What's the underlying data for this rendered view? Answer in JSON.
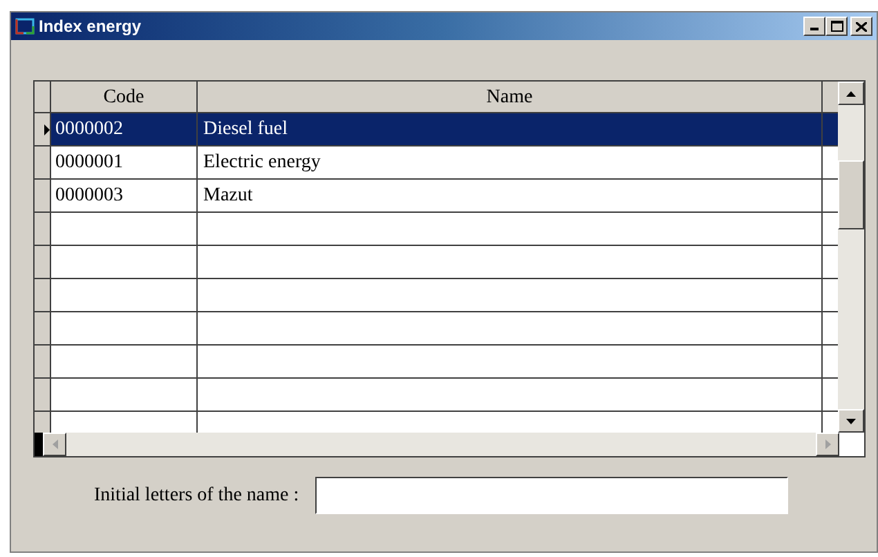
{
  "window": {
    "title": "Index energy"
  },
  "table": {
    "columns": [
      "Code",
      "Name"
    ],
    "rows": [
      {
        "code": "0000002",
        "name": "Diesel fuel",
        "selected": true
      },
      {
        "code": "0000001",
        "name": "Electric energy",
        "selected": false
      },
      {
        "code": "0000003",
        "name": "Mazut",
        "selected": false
      }
    ]
  },
  "filter": {
    "label": "Initial letters of the name :"
  }
}
